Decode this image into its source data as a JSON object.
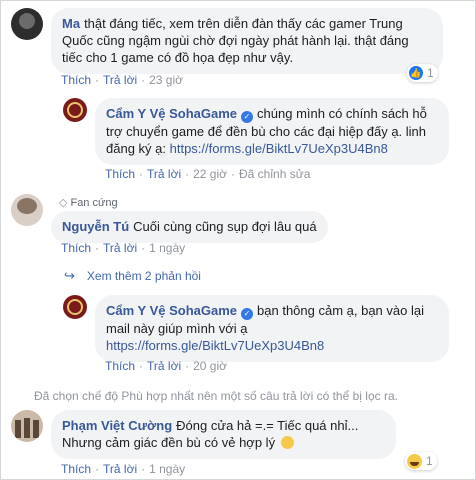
{
  "comments": [
    {
      "author": "Ma",
      "text": "thật đáng tiếc, xem trên diễn đàn thấy các gamer Trung Quốc cũng ngậm ngùi chờ đợi ngày phát hành lại. thật đáng tiếc cho 1 game có đồ họa đẹp như vậy.",
      "actions": [
        "Thích",
        "Trả lời"
      ],
      "time": "23 giờ",
      "reaction_count": "1",
      "reply": {
        "author": "Cẩm Y Vệ SohaGame",
        "text": "chúng mình có chính sách hỗ trợ chuyển game để đền bù cho các đại hiệp đấy ạ. linh đăng ký ạ: ",
        "link": "https://forms.gle/BiktLv7UeXp3U4Bn8",
        "actions": [
          "Thích",
          "Trả lời"
        ],
        "time": "22 giờ",
        "edited": "Đã chỉnh sửa"
      }
    },
    {
      "badge": "Fan cứng",
      "author": "Nguyễn Tú",
      "text": "Cuối cùng cũng sụp đợi lâu quá",
      "actions": [
        "Thích",
        "Trả lời"
      ],
      "time": "1 ngày",
      "more_replies": "Xem thêm 2 phản hồi",
      "reply": {
        "author": "Cẩm Y Vệ SohaGame",
        "text": "bạn thông cảm ạ, bạn vào lại mail này giúp mình với ạ",
        "link": "https://forms.gle/BiktLv7UeXp3U4Bn8",
        "actions": [
          "Thích",
          "Trả lời"
        ],
        "time": "20 giờ"
      }
    }
  ],
  "filter_note": "Đã chọn chế độ Phù hợp nhất nên một số câu trả lời có thể bị lọc ra.",
  "last_comment": {
    "author": "Phạm Việt Cường",
    "text": "Đóng cửa hả =.= Tiếc quá nhỉ... Nhưng cảm giác đền bù có vẻ hợp lý",
    "actions": [
      "Thích",
      "Trả lời"
    ],
    "time": "1 ngày",
    "reaction_count": "1"
  },
  "colors": {
    "link": "#385898",
    "action": "#4267b2",
    "bubble": "#f2f3f5",
    "meta": "#90949c"
  },
  "icons": [
    "like-icon",
    "haha-icon",
    "verified-icon",
    "diamond-icon",
    "reply-arrow-icon",
    "smile-emoji-icon"
  ]
}
